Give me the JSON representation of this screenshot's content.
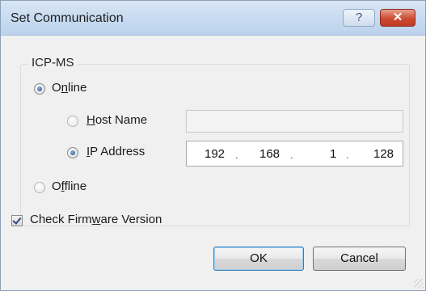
{
  "window": {
    "title": "Set Communication",
    "help_glyph": "?",
    "close_glyph": "✕"
  },
  "group": {
    "title": "ICP-MS"
  },
  "connection": {
    "online_pre": "O",
    "online_mn": "n",
    "online_post": "line",
    "online_checked": true,
    "host_mn": "H",
    "host_post": "ost Name",
    "host_checked": false,
    "host_value": "",
    "ip_mn": "I",
    "ip_post": "P Address",
    "ip_checked": true,
    "ip_octets": [
      "192",
      "168",
      "1",
      "128"
    ],
    "offline_pre": "O",
    "offline_mn": "f",
    "offline_post": "fline",
    "offline_checked": false
  },
  "firmware": {
    "pre": "Check Firm",
    "mn": "w",
    "post": "are Version",
    "checked": true
  },
  "buttons": {
    "ok": "OK",
    "cancel": "Cancel"
  }
}
